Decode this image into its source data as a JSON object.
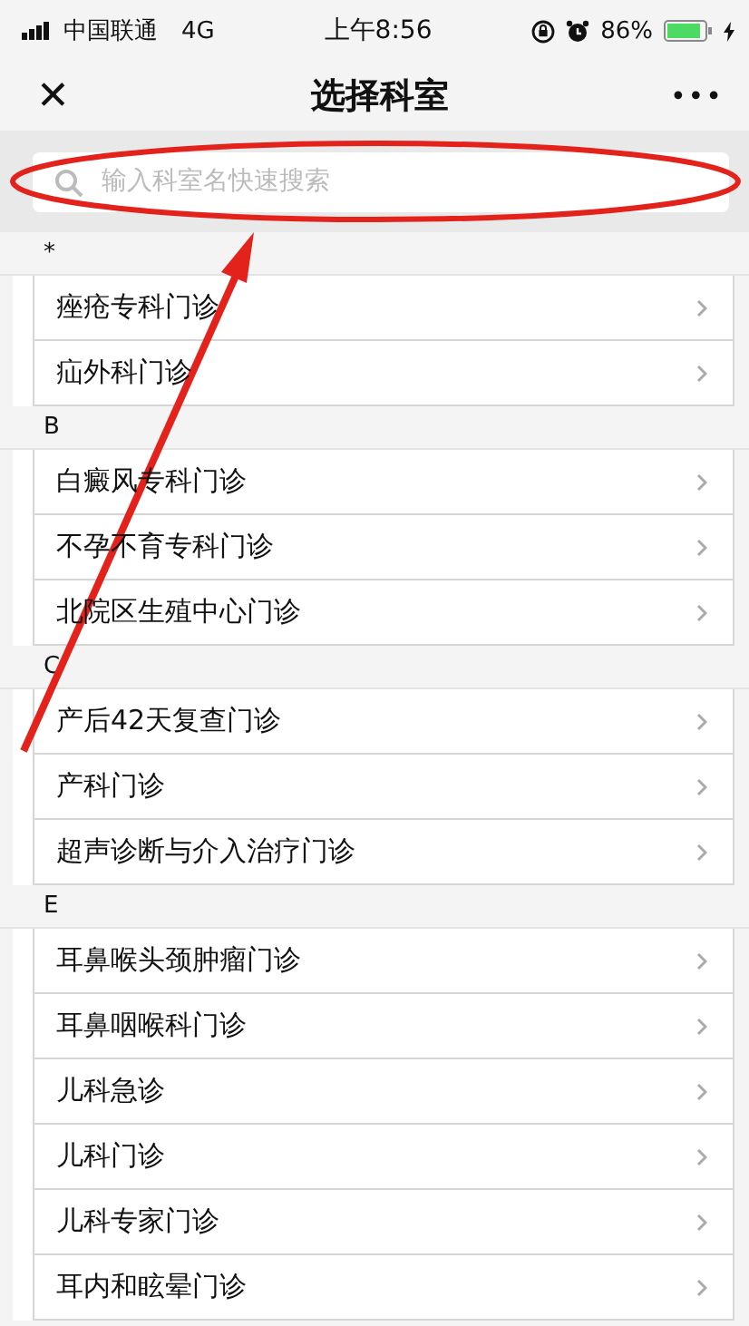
{
  "status_bar": {
    "carrier": "中国联通",
    "network": "4G",
    "time": "上午8:56",
    "battery": "86%"
  },
  "nav": {
    "close": "✕",
    "title": "选择科室",
    "more": "•••"
  },
  "search": {
    "placeholder": "输入科室名快速搜索"
  },
  "sections": [
    {
      "letter": "*",
      "items": [
        "痤疮专科门诊",
        "疝外科门诊"
      ]
    },
    {
      "letter": "B",
      "items": [
        "白癜风专科门诊",
        "不孕不育专科门诊",
        "北院区生殖中心门诊"
      ]
    },
    {
      "letter": "C",
      "items": [
        "产后42天复查门诊",
        "产科门诊",
        "超声诊断与介入治疗门诊"
      ]
    },
    {
      "letter": "E",
      "items": [
        "耳鼻喉头颈肿瘤门诊",
        "耳鼻咽喉科门诊",
        "儿科急诊",
        "儿科门诊",
        "儿科专家门诊",
        "耳内和眩晕门诊"
      ]
    }
  ]
}
